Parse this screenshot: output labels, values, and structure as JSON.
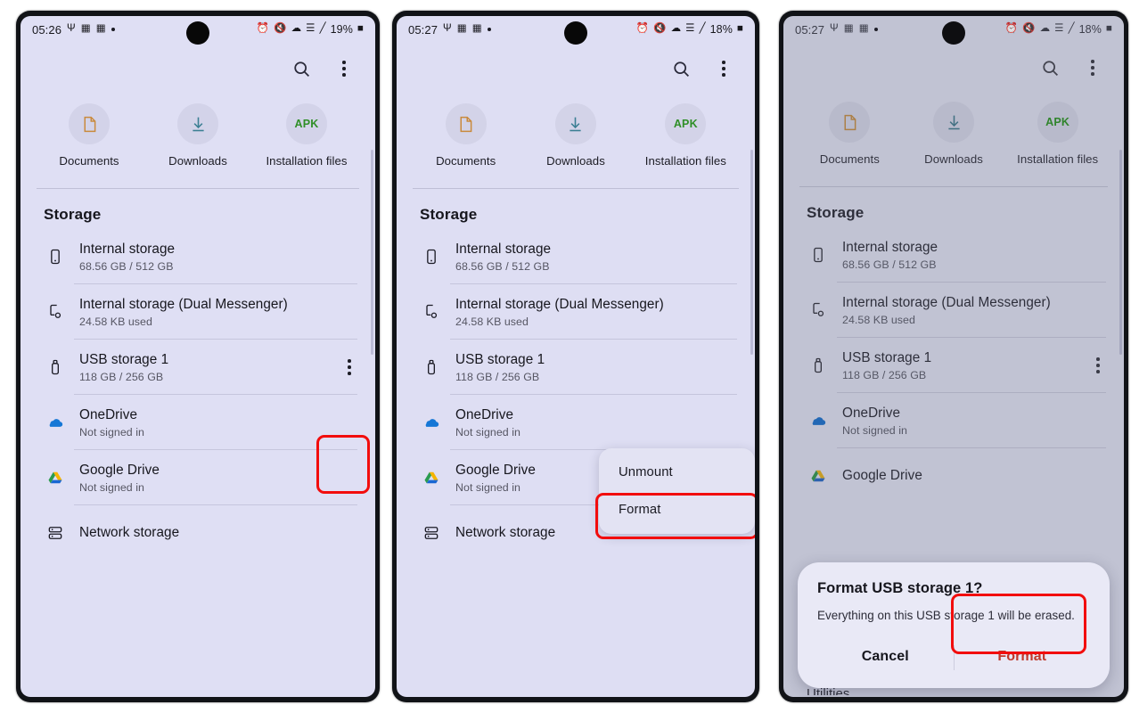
{
  "meta": {
    "app": "My Files",
    "accent_red": "#f20d0d",
    "apk_green": "#2f8f27",
    "dialog_format_red": "#c0392b"
  },
  "panels": [
    {
      "id": "panel-1",
      "status": {
        "time": "05:26",
        "icons": [
          "usb-icon",
          "split-screen-icon",
          "picture-in-picture-icon",
          "dot-icon"
        ],
        "right_icons": [
          "alarm-icon",
          "mute-icon",
          "wifi-icon",
          "vowifi-icon",
          "signal-icon"
        ],
        "battery": "19%"
      },
      "appbar": {
        "search": "search-icon",
        "more": "more-options-icon"
      },
      "shortcuts": [
        {
          "label": "Documents",
          "icon": "document-icon"
        },
        {
          "label": "Downloads",
          "icon": "download-icon"
        },
        {
          "label": "Installation files",
          "icon": "apk-icon",
          "icon_text": "APK"
        }
      ],
      "storage": {
        "heading": "Storage",
        "items": [
          {
            "title": "Internal storage",
            "subtitle": "68.56 GB / 512 GB",
            "icon": "phone-icon",
            "kebab": false
          },
          {
            "title": "Internal storage (Dual Messenger)",
            "subtitle": "24.58 KB used",
            "icon": "dual-messenger-icon",
            "kebab": false
          },
          {
            "title": "USB storage 1",
            "subtitle": "118 GB / 256 GB",
            "icon": "usb-drive-icon",
            "kebab": true,
            "highlight_kebab": true
          },
          {
            "title": "OneDrive",
            "subtitle": "Not signed in",
            "icon": "onedrive-icon",
            "kebab": false
          },
          {
            "title": "Google Drive",
            "subtitle": "Not signed in",
            "icon": "google-drive-icon",
            "kebab": false
          },
          {
            "title": "Network storage",
            "subtitle": "",
            "icon": "network-storage-icon",
            "kebab": false
          }
        ]
      }
    },
    {
      "id": "panel-2",
      "status": {
        "time": "05:27",
        "battery": "18%"
      },
      "shortcuts": [
        {
          "label": "Documents"
        },
        {
          "label": "Downloads"
        },
        {
          "label": "Installation files",
          "icon_text": "APK"
        }
      ],
      "storage": {
        "heading": "Storage",
        "items": [
          {
            "title": "Internal storage",
            "subtitle": "68.56 GB / 512 GB"
          },
          {
            "title": "Internal storage (Dual Messenger)",
            "subtitle": "24.58 KB used"
          },
          {
            "title": "USB storage 1",
            "subtitle": "118 GB / 256 GB"
          },
          {
            "title": "OneDrive",
            "subtitle": "Not signed in"
          },
          {
            "title": "Google Drive",
            "subtitle": "Not signed in"
          },
          {
            "title": "Network storage",
            "subtitle": ""
          }
        ]
      },
      "popup_menu": {
        "items": [
          {
            "label": "Unmount",
            "highlighted": false
          },
          {
            "label": "Format",
            "highlighted": true
          }
        ]
      }
    },
    {
      "id": "panel-3",
      "status": {
        "time": "05:27",
        "battery": "18%"
      },
      "shortcuts": [
        {
          "label": "Documents"
        },
        {
          "label": "Downloads"
        },
        {
          "label": "Installation files",
          "icon_text": "APK"
        }
      ],
      "storage": {
        "heading": "Storage",
        "items": [
          {
            "title": "Internal storage",
            "subtitle": "68.56 GB / 512 GB"
          },
          {
            "title": "Internal storage (Dual Messenger)",
            "subtitle": "24.58 KB used"
          },
          {
            "title": "USB storage 1",
            "subtitle": "118 GB / 256 GB"
          },
          {
            "title": "OneDrive",
            "subtitle": "Not signed in"
          },
          {
            "title": "Google Drive",
            "subtitle": ""
          }
        ],
        "cutoff_text": "Utilities"
      },
      "dialog": {
        "title": "Format USB storage 1?",
        "body": "Everything on this USB storage 1 will be erased.",
        "cancel_label": "Cancel",
        "confirm_label": "Format",
        "confirm_highlighted": true
      }
    }
  ]
}
